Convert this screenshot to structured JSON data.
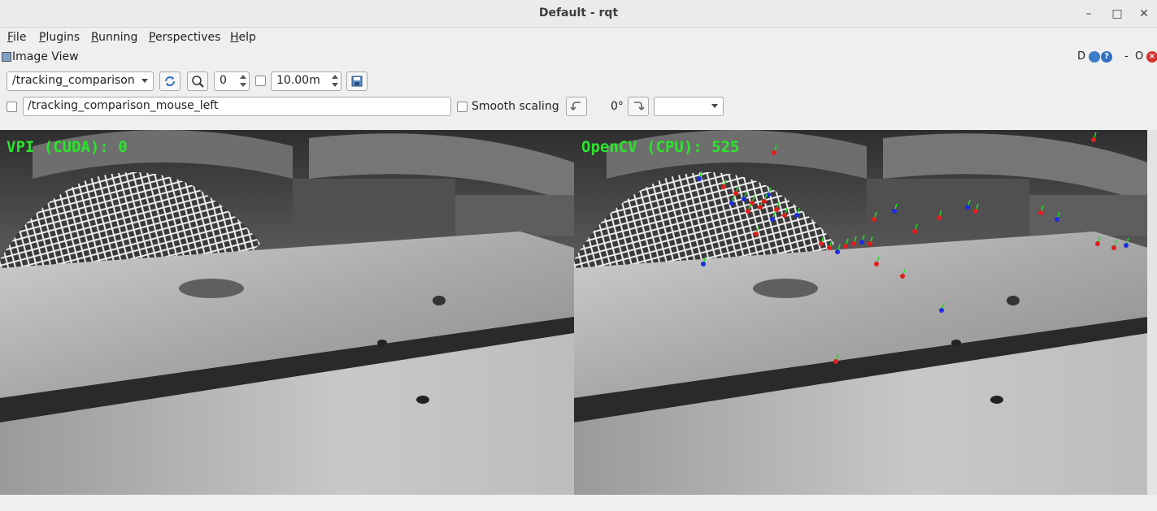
{
  "window": {
    "title": "Default - rqt",
    "minimize": "–",
    "maximize": "□",
    "close": "✕"
  },
  "menu": [
    {
      "u": "F",
      "rest": "ile"
    },
    {
      "u": "P",
      "rest": "lugins"
    },
    {
      "u": "R",
      "rest": "unning"
    },
    {
      "u": "P",
      "rest": "erspectives"
    },
    {
      "u": "H",
      "rest": "elp"
    }
  ],
  "plugin": {
    "title": "Image View",
    "d_label": "D",
    "help_glyph": "?",
    "dash": "-",
    "o_label": "O",
    "close_glyph": "×"
  },
  "toolbar": {
    "topic": "/tracking_comparison",
    "spin_value": "0",
    "duration_value": "10.00m",
    "mouse_topic": "/tracking_comparison_mouse_left",
    "smooth_scaling_label": "Smooth scaling",
    "rotation_label": "0°",
    "rotation_select": ""
  },
  "view": {
    "left_label": "VPI (CUDA): 0",
    "right_label": "OpenCV (CPU): 525"
  },
  "colors": {
    "overlay_text": "#2be52b",
    "point_red": "#e11d1d",
    "point_blue": "#1d2be1",
    "point_green": "#1ee01e"
  }
}
